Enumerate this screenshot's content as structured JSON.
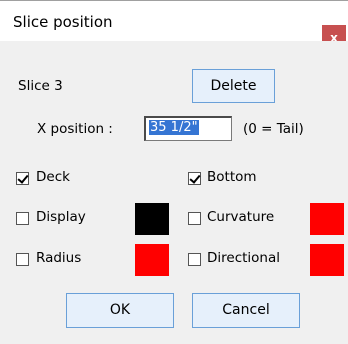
{
  "window": {
    "title": "Slice position",
    "close_glyph": "x"
  },
  "slice": {
    "label": "Slice 3",
    "delete_label": "Delete"
  },
  "x_position": {
    "label": "X position :",
    "value": "35 1/2\"",
    "hint": "(0 = Tail)"
  },
  "options": {
    "deck": {
      "label": "Deck",
      "checked": true
    },
    "bottom": {
      "label": "Bottom",
      "checked": true
    },
    "display": {
      "label": "Display",
      "checked": false,
      "color": "#000000"
    },
    "curvature": {
      "label": "Curvature",
      "checked": false,
      "color": "#ff0000"
    },
    "radius": {
      "label": "Radius",
      "checked": false,
      "color": "#ff0000"
    },
    "directional": {
      "label": "Directional",
      "checked": false,
      "color": "#ff0000"
    }
  },
  "footer": {
    "ok_label": "OK",
    "cancel_label": "Cancel"
  },
  "colors": {
    "close_bg": "#c75050",
    "button_bg": "#e6f0fb",
    "button_border": "#6aa0d8",
    "selection": "#3575d3"
  }
}
